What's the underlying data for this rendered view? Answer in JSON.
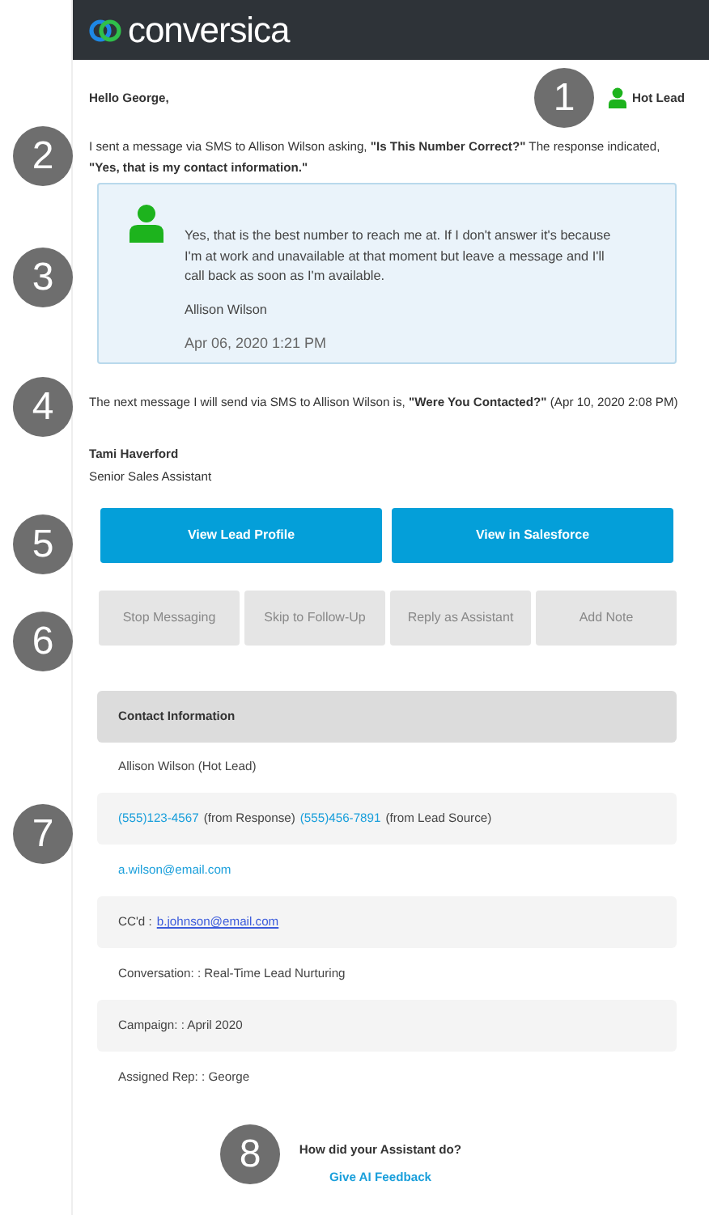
{
  "header": {
    "logo_text": "conversica"
  },
  "greeting": "Hello George,",
  "lead_status": {
    "label": "Hot Lead",
    "color": "#1db31d"
  },
  "intro": "I sent a message via SMS to Allison Wilson asking, **\"Is This Number Correct?\"** The response indicated, **\"Yes, that is my contact information.\"**",
  "response_card": {
    "message": "Yes, that is the best number to reach me at. If I don't answer it's because I'm at work and unavailable at that moment but leave a message and I'll call back as soon as I'm available.",
    "sender": "Allison Wilson",
    "time": "Apr 06, 2020 1:21 PM"
  },
  "next_message": "The next message I will send via SMS to Allison Wilson is, **\"Were You Contacted?\"** (Apr 10, 2020 2:08 PM)",
  "signature": {
    "name": "Tami Haverford",
    "title": "Senior Sales Assistant"
  },
  "primary_buttons": [
    "View Lead Profile",
    "View in Salesforce"
  ],
  "secondary_buttons": [
    "Stop Messaging",
    "Skip to Follow-Up",
    "Reply as Assistant",
    "Add Note"
  ],
  "contact_information": {
    "title": "Contact Information",
    "rows": [
      {
        "shaded": false,
        "parts": [
          {
            "kind": "text",
            "text": "Allison Wilson (Hot Lead)"
          }
        ]
      },
      {
        "shaded": true,
        "parts": [
          {
            "kind": "link",
            "text": "(555)123-4567"
          },
          {
            "kind": "text",
            "text": "(from Response)"
          },
          {
            "kind": "link",
            "text": "(555)456-7891"
          },
          {
            "kind": "text",
            "text": "(from Lead Source)"
          }
        ]
      },
      {
        "shaded": false,
        "parts": [
          {
            "kind": "link",
            "text": "a.wilson@email.com"
          }
        ]
      },
      {
        "shaded": true,
        "parts": [
          {
            "kind": "text",
            "text": "CC'd :"
          },
          {
            "kind": "underlined_link",
            "text": "b.johnson@email.com"
          }
        ]
      },
      {
        "shaded": false,
        "parts": [
          {
            "kind": "text",
            "text": "Conversation: : Real-Time Lead Nurturing"
          }
        ]
      },
      {
        "shaded": true,
        "parts": [
          {
            "kind": "text",
            "text": "Campaign: : April 2020"
          }
        ]
      },
      {
        "shaded": false,
        "parts": [
          {
            "kind": "text",
            "text": "Assigned Rep: : George"
          }
        ]
      }
    ]
  },
  "feedback": {
    "question": "How did your Assistant do?",
    "link": "Give AI Feedback"
  },
  "annotation_markers": [
    "1",
    "2",
    "3",
    "4",
    "5",
    "6",
    "7",
    "8"
  ]
}
